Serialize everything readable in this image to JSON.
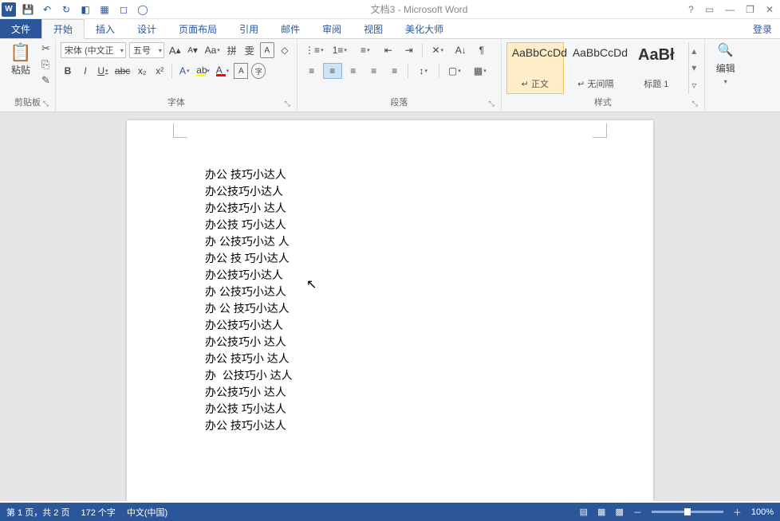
{
  "app": {
    "title": "文档3 - Microsoft Word",
    "icon_letter": "W"
  },
  "qat": {
    "save": "💾",
    "undo": "↶",
    "redo": "↻",
    "shapes": "◧",
    "table": "▦",
    "more": "◻",
    "circle": "◯"
  },
  "win": {
    "help": "?",
    "ribbon_toggle": "▭",
    "min": "—",
    "restore": "❐",
    "close": "✕"
  },
  "tabs": {
    "file": "文件",
    "home": "开始",
    "insert": "插入",
    "design": "设计",
    "layout": "页面布局",
    "ref": "引用",
    "mail": "邮件",
    "review": "审阅",
    "view": "视图",
    "beautify": "美化大师",
    "login": "登录"
  },
  "ribbon": {
    "clipboard": {
      "paste": "粘贴",
      "cut": "✂",
      "copy": "⎘",
      "brush": "✎",
      "label": "剪贴板"
    },
    "font": {
      "name_sel": "宋体 (中文正",
      "size_sel": "五号",
      "grow": "A",
      "shrink": "A",
      "case": "Aa",
      "tone": "拼",
      "border": "雯",
      "circled": "A",
      "clear": "◇",
      "bold": "B",
      "italic": "I",
      "underline": "U",
      "strike": "abc",
      "sub": "x₂",
      "sup": "x²",
      "fx": "A",
      "highlight": "ab",
      "color": "A",
      "char_a": "A",
      "circled2": "字",
      "label": "字体"
    },
    "para": {
      "label": "段落",
      "bul": "⋮≡",
      "num": "1≡",
      "multi": "≡",
      "inc": "⇤",
      "dec": "⇥",
      "sort": "A↓",
      "marks": "¶",
      "al": "≡",
      "ac": "≡",
      "ar": "≡",
      "aj": "≡",
      "ad": "≡",
      "ls": "↕",
      "shade": "▢",
      "bord": "▦"
    },
    "styles": {
      "label": "样式",
      "items": [
        {
          "preview": "AaBbCcDd",
          "name": "↵ 正文"
        },
        {
          "preview": "AaBbCcDd",
          "name": "↵ 无间隔"
        },
        {
          "preview": "AaBł",
          "name": "标题 1"
        }
      ]
    },
    "edit": {
      "label": "编辑",
      "find": "🔍"
    }
  },
  "document": {
    "lines": [
      "办公 技巧小达人",
      "办公技巧小达人",
      "办公技巧小 达人",
      "办公技 巧小达人",
      "办 公技巧小达 人",
      "办公 技 巧小达人",
      "办公技巧小达人",
      "办 公技巧小达人",
      "办 公 技巧小达人",
      "办公技巧小达人",
      "办公技巧小 达人",
      "办公 技巧小 达人",
      "办  公技巧小 达人",
      "办公技巧小 达人",
      "办公技 巧小达人",
      "办公 技巧小达人"
    ]
  },
  "status": {
    "page": "第 1 页，共 2 页",
    "words": "172 个字",
    "lang": "中文(中国)",
    "zoom": "100%"
  }
}
